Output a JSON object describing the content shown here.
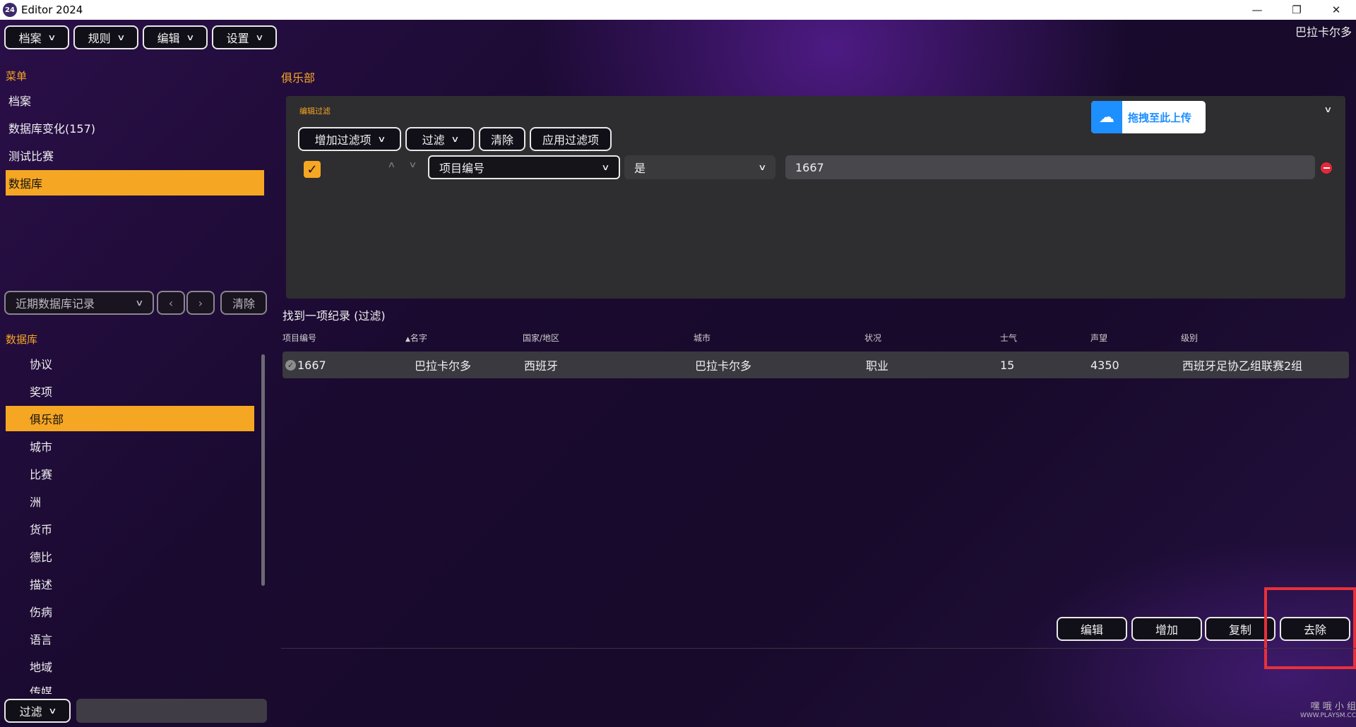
{
  "window": {
    "title": "Editor 2024",
    "icon_text": "24"
  },
  "menubar": [
    "档案",
    "规则",
    "编辑",
    "设置"
  ],
  "top_right_label": "巴拉卡尔多",
  "sidebar": {
    "menu_label": "菜单",
    "items": [
      "档案",
      "数据库变化(157)",
      "测试比赛",
      "数据库"
    ],
    "active_index": 3,
    "history_dropdown": "近期数据库记录",
    "clear_label": "清除",
    "db_label": "数据库",
    "db_items": [
      "协议",
      "奖项",
      "俱乐部",
      "城市",
      "比赛",
      "洲",
      "货币",
      "德比",
      "描述",
      "伤病",
      "语言",
      "地域",
      "传媒"
    ],
    "db_active_index": 2,
    "filter_dropdown": "过滤"
  },
  "main": {
    "title": "俱乐部",
    "filter_panel": {
      "label": "编辑过滤",
      "upload_label": "拖拽至此上传",
      "buttons": [
        "增加过滤项",
        "过滤",
        "清除",
        "应用过滤项"
      ],
      "row": {
        "checked": true,
        "field": "项目编号",
        "operator": "是",
        "value": "1667"
      }
    },
    "results_label": "找到一项纪录 (过滤)",
    "columns": [
      "项目编号",
      "名字",
      "国家/地区",
      "城市",
      "状况",
      "士气",
      "声望",
      "级别"
    ],
    "rows": [
      [
        "1667",
        "巴拉卡尔多",
        "西班牙",
        "巴拉卡尔多",
        "职业",
        "15",
        "4350",
        "西班牙足协乙组联赛2组"
      ]
    ],
    "actions": [
      "编辑",
      "增加",
      "复制",
      "去除"
    ]
  },
  "watermark": {
    "line1": "嘿 哦 小 组",
    "line2": "WWW.PLAYSM.CC"
  },
  "colors": {
    "accent": "#f5a623",
    "highlight_box": "#e8303a",
    "upload_blue": "#1e8fff"
  }
}
